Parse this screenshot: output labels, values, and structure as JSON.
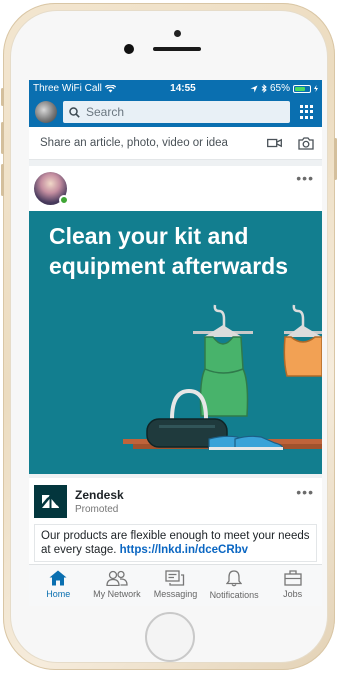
{
  "status_bar": {
    "carrier": "Three WiFi Call",
    "time": "14:55",
    "battery_percent": "65%",
    "battery_level": 0.65
  },
  "search": {
    "placeholder": "Search"
  },
  "share": {
    "prompt": "Share an article, photo, video or idea"
  },
  "post": {
    "headline": "Clean your kit and equipment afterwards",
    "more": "•••"
  },
  "ad": {
    "company": "Zendesk",
    "label": "Promoted",
    "text": "Our products are flexible enough to meet your needs at every stage.",
    "link": "https://lnkd.in/dceCRbv",
    "more": "•••"
  },
  "tabs": [
    {
      "label": "Home",
      "icon": "home-icon",
      "active": true
    },
    {
      "label": "My Network",
      "icon": "network-icon",
      "active": false
    },
    {
      "label": "Messaging",
      "icon": "messaging-icon",
      "active": false
    },
    {
      "label": "Notifications",
      "icon": "bell-icon",
      "active": false
    },
    {
      "label": "Jobs",
      "icon": "briefcase-icon",
      "active": false
    }
  ],
  "colors": {
    "brand_blue": "#0a6fb0",
    "image_teal": "#127e8f",
    "link_blue": "#0a66c2",
    "online_green": "#3fa535"
  }
}
